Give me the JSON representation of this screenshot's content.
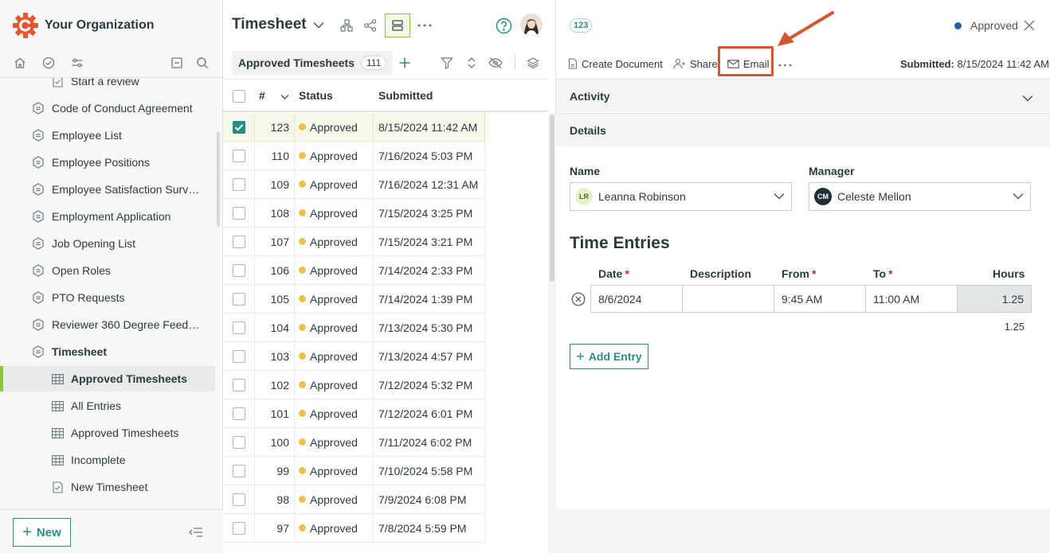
{
  "sidebar": {
    "org_name": "Your Organization",
    "tree": [
      {
        "label": "Start a review",
        "level": 2,
        "icon": "form-icon"
      },
      {
        "label": "Code of Conduct Agreement",
        "level": 1,
        "icon": "app-icon"
      },
      {
        "label": "Employee List",
        "level": 1,
        "icon": "app-icon"
      },
      {
        "label": "Employee Positions",
        "level": 1,
        "icon": "app-icon"
      },
      {
        "label": "Employee Satisfaction Surve...",
        "level": 1,
        "icon": "app-icon"
      },
      {
        "label": "Employment Application",
        "level": 1,
        "icon": "app-icon"
      },
      {
        "label": "Job Opening List",
        "level": 1,
        "icon": "app-icon"
      },
      {
        "label": "Open Roles",
        "level": 1,
        "icon": "app-icon"
      },
      {
        "label": "PTO Requests",
        "level": 1,
        "icon": "app-icon"
      },
      {
        "label": "Reviewer 360 Degree Feedb...",
        "level": 1,
        "icon": "app-icon"
      },
      {
        "label": "Timesheet",
        "level": 1,
        "icon": "app-icon",
        "bold": true
      },
      {
        "label": "Approved Timesheets",
        "level": 2,
        "icon": "table-icon",
        "bold": true,
        "active": true
      },
      {
        "label": "All Entries",
        "level": 2,
        "icon": "table-icon"
      },
      {
        "label": "Approved Timesheets",
        "level": 2,
        "icon": "table-icon"
      },
      {
        "label": "Incomplete",
        "level": 2,
        "icon": "table-icon"
      },
      {
        "label": "New Timesheet",
        "level": 2,
        "icon": "form-icon"
      }
    ],
    "new_label": "New"
  },
  "list": {
    "app_title": "Timesheet",
    "view_name": "Approved Timesheets",
    "view_count": "111",
    "columns": {
      "num": "#",
      "status": "Status",
      "submitted": "Submitted"
    },
    "rows": [
      {
        "num": "123",
        "status": "Approved",
        "submitted": "8/15/2024 11:42 AM",
        "selected": true
      },
      {
        "num": "110",
        "status": "Approved",
        "submitted": "7/16/2024 5:03 PM"
      },
      {
        "num": "109",
        "status": "Approved",
        "submitted": "7/16/2024 12:31 AM"
      },
      {
        "num": "108",
        "status": "Approved",
        "submitted": "7/15/2024 3:25 PM"
      },
      {
        "num": "107",
        "status": "Approved",
        "submitted": "7/15/2024 3:21 PM"
      },
      {
        "num": "106",
        "status": "Approved",
        "submitted": "7/14/2024 2:33 PM"
      },
      {
        "num": "105",
        "status": "Approved",
        "submitted": "7/14/2024 1:39 PM"
      },
      {
        "num": "104",
        "status": "Approved",
        "submitted": "7/13/2024 5:30 PM"
      },
      {
        "num": "103",
        "status": "Approved",
        "submitted": "7/13/2024 4:57 PM"
      },
      {
        "num": "102",
        "status": "Approved",
        "submitted": "7/12/2024 5:32 PM"
      },
      {
        "num": "101",
        "status": "Approved",
        "submitted": "7/12/2024 6:01 PM"
      },
      {
        "num": "100",
        "status": "Approved",
        "submitted": "7/11/2024 6:02 PM"
      },
      {
        "num": "99",
        "status": "Approved",
        "submitted": "7/10/2024 5:58 PM"
      },
      {
        "num": "98",
        "status": "Approved",
        "submitted": "7/9/2024 6:08 PM"
      },
      {
        "num": "97",
        "status": "Approved",
        "submitted": "7/8/2024 5:59 PM"
      }
    ]
  },
  "detail": {
    "record_id": "123",
    "status": "Approved",
    "actions": {
      "create_document": "Create Document",
      "share": "Share",
      "email": "Email"
    },
    "submitted_label": "Submitted:",
    "submitted_value": "8/15/2024 11:42 AM",
    "sections": {
      "activity": "Activity",
      "details": "Details"
    },
    "name_label": "Name",
    "name_initials": "LR",
    "name_value": "Leanna Robinson",
    "manager_label": "Manager",
    "manager_initials": "CM",
    "manager_value": "Celeste Mellon",
    "time_entries_title": "Time Entries",
    "te_columns": {
      "date": "Date",
      "description": "Description",
      "from": "From",
      "to": "To",
      "hours": "Hours"
    },
    "entry": {
      "date": "8/6/2024",
      "description": "",
      "from": "9:45 AM",
      "to": "11:00 AM",
      "hours": "1.25"
    },
    "total_hours": "1.25",
    "add_entry_label": "Add Entry"
  },
  "colors": {
    "accent": "#2a8c82",
    "brand": "#e0592a",
    "highlight": "#d2572f",
    "approved_dot": "#eec14b",
    "status_dot": "#2b5aa8",
    "active_bar": "#8cc63f"
  }
}
